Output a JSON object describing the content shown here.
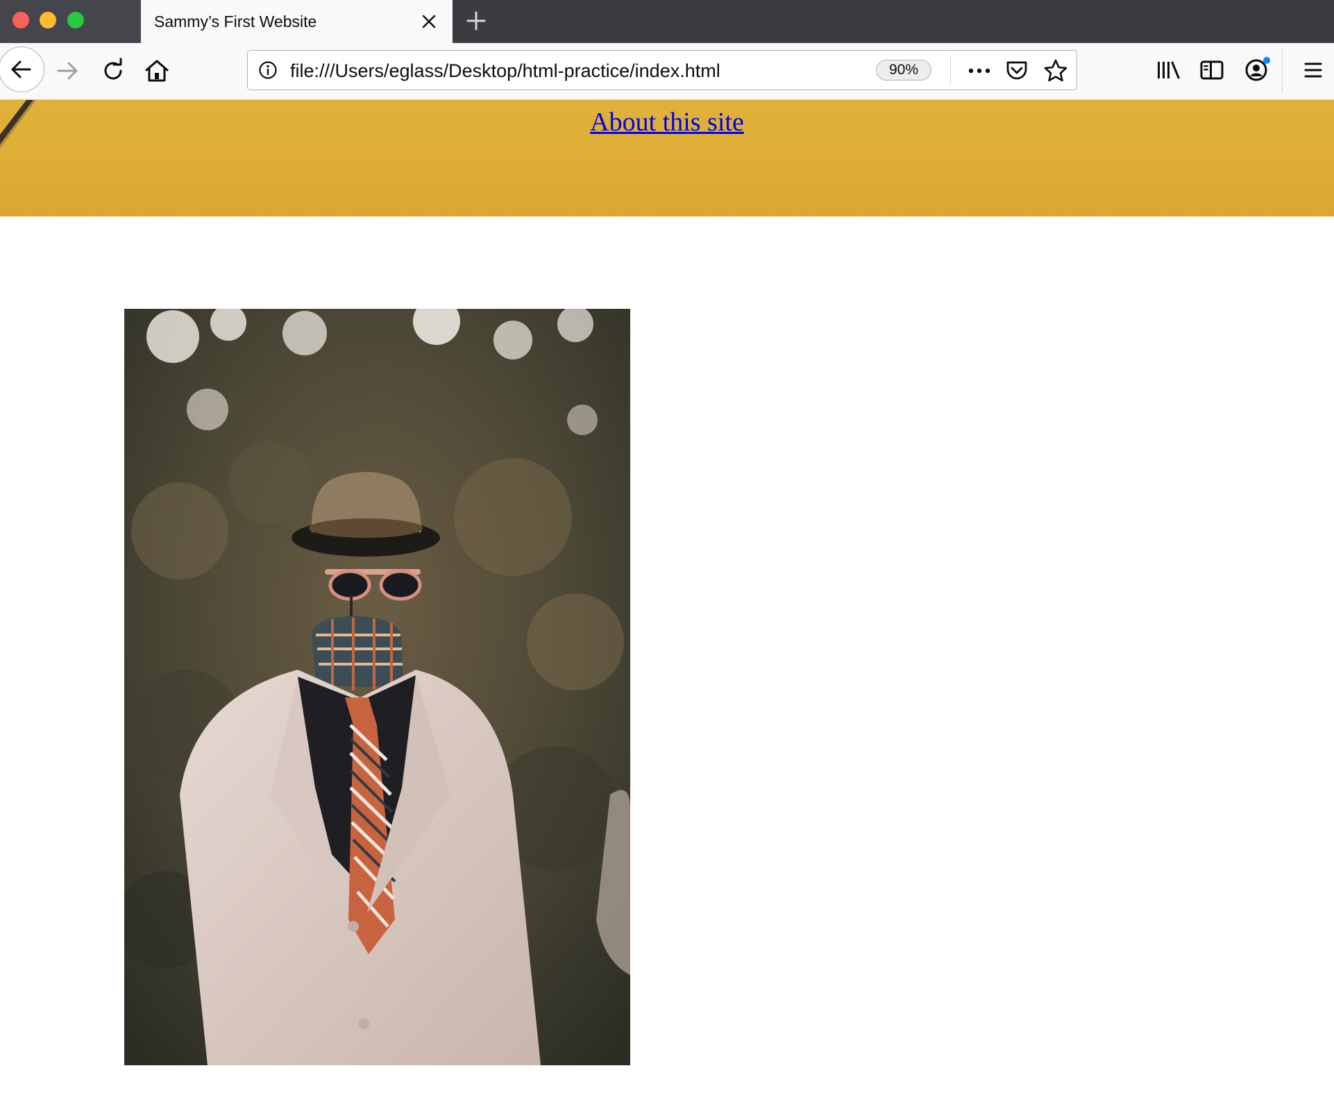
{
  "browser": {
    "tab": {
      "title": "Sammy’s First Website"
    },
    "url": "file:///Users/eglass/Desktop/html-practice/index.html",
    "zoom": "90%",
    "icons": {
      "close_tab": "close-icon",
      "new_tab": "plus-icon",
      "back": "arrow-left-icon",
      "forward": "arrow-right-icon",
      "reload": "reload-icon",
      "home": "home-icon",
      "site_info": "info-icon",
      "page_actions": "more-horizontal-icon",
      "pocket": "pocket-icon",
      "bookmark": "star-icon",
      "library": "library-icon",
      "sidebar": "sidebar-icon",
      "account": "account-icon",
      "menu": "hamburger-icon"
    }
  },
  "page": {
    "banner_color": "#deae36",
    "link_color": "#0000ee",
    "about_link": "About this site",
    "photo": {
      "subject": "headless mannequin in beige suit, plaid cap, striped tie, hat and sunglasses"
    }
  }
}
